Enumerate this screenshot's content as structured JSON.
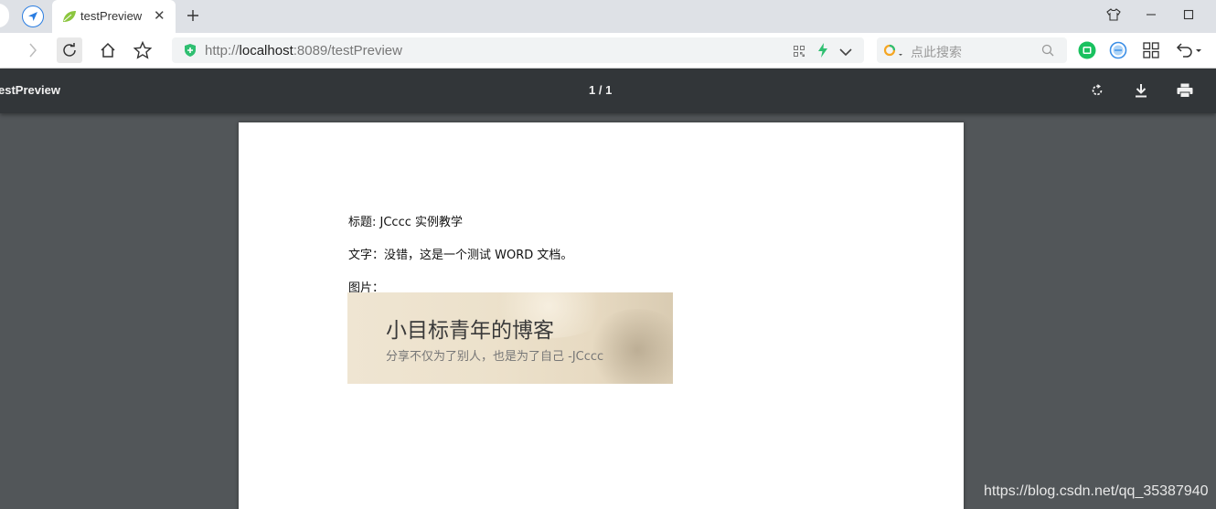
{
  "browser": {
    "tab": {
      "title": "testPreview",
      "close_label": "✕"
    },
    "new_tab_label": "+",
    "url": {
      "scheme": "http://",
      "host": "localhost",
      "rest": ":8089/testPreview"
    },
    "search": {
      "placeholder": "点此搜索"
    }
  },
  "pdf_viewer": {
    "title": "estPreview",
    "page_indicator": "1 / 1"
  },
  "document": {
    "line1": "标题: JCccc 实例教学",
    "line2": "文字：没错，这是一个测试  WORD 文档。",
    "line3": "图片：",
    "banner": {
      "title": "小目标青年的博客",
      "subtitle": "分享不仅为了别人，也是为了自己 -JCccc"
    }
  },
  "watermark": "https://blog.csdn.net/qq_35387940",
  "colors": {
    "accent_blue": "#2a7de1",
    "secure_green": "#2fbf71",
    "viewer_bar": "#323639",
    "viewer_bg": "#525659"
  }
}
